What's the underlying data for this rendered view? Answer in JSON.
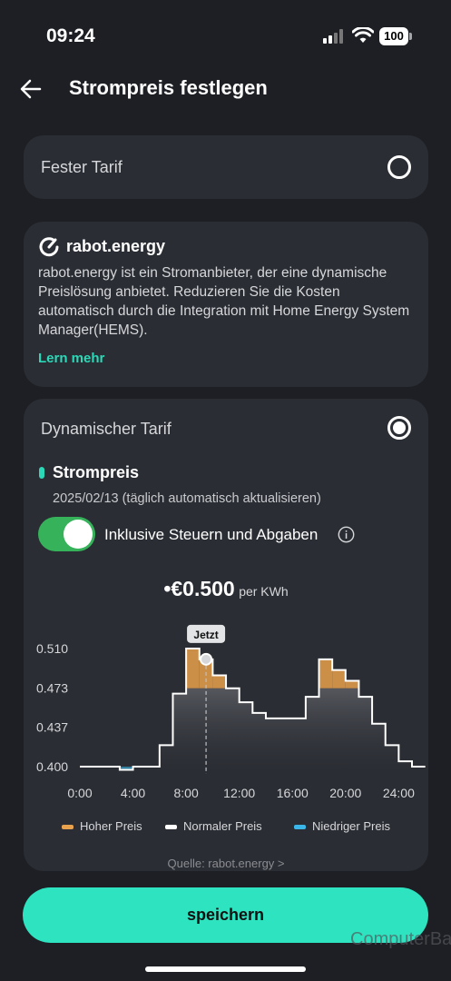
{
  "status_bar": {
    "time": "09:24",
    "battery": "100"
  },
  "header": {
    "title": "Strompreis festlegen"
  },
  "fixed_tariff": {
    "label": "Fester Tarif",
    "selected": false
  },
  "rabot": {
    "name": "rabot.energy",
    "description": "rabot.energy ist ein Stromanbieter, der eine dynamische Preislösung anbietet. Reduzieren Sie die Kosten automatisch durch die Integration mit Home Energy System Manager(HEMS).",
    "learn_more": "Lern mehr"
  },
  "dynamic_tariff": {
    "label": "Dynamischer Tarif",
    "selected": true,
    "price_heading": "Strompreis",
    "date": "2025/02/13 (täglich automatisch aktualisieren)",
    "toggle_label": "Inklusive Steuern und Abgaben",
    "toggle_on": true,
    "current_price": "•€0.500",
    "current_unit": "per KWh",
    "source": "Quelle: rabot.energy >"
  },
  "chart_data": {
    "type": "line",
    "step": true,
    "x_ticks": [
      "0:00",
      "4:00",
      "8:00",
      "12:00",
      "16:00",
      "20:00",
      "24:00"
    ],
    "y_ticks": [
      "0.510",
      "0.473",
      "0.437",
      "0.400"
    ],
    "ylim": [
      0.4,
      0.51
    ],
    "xlim": [
      0,
      25
    ],
    "marker_label": "Jetzt",
    "marker_hour": 9.5,
    "hours": [
      0,
      1,
      2,
      3,
      4,
      5,
      6,
      7,
      8,
      9,
      10,
      11,
      12,
      13,
      14,
      15,
      16,
      17,
      18,
      19,
      20,
      21,
      22,
      23,
      24,
      25
    ],
    "prices": [
      0.4,
      0.4,
      0.4,
      0.397,
      0.4,
      0.4,
      0.42,
      0.468,
      0.51,
      0.5,
      0.485,
      0.473,
      0.46,
      0.45,
      0.445,
      0.445,
      0.445,
      0.465,
      0.5,
      0.49,
      0.48,
      0.465,
      0.44,
      0.42,
      0.405,
      0.4
    ],
    "colors": {
      "high": "#e8a14c",
      "normal": "#ffffff",
      "low": "#3bb6e8"
    }
  },
  "legend": {
    "high": "Hoher Preis",
    "normal": "Normaler Preis",
    "low": "Niedriger Preis"
  },
  "save_label": "speichern",
  "watermark": "ComputerBase"
}
